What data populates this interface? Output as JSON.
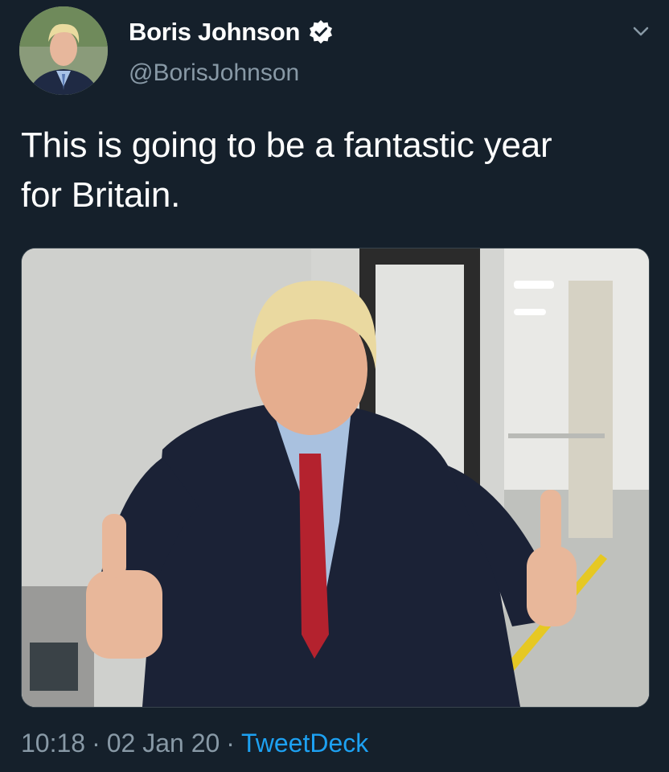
{
  "author": {
    "display_name": "Boris Johnson",
    "handle": "@BorisJohnson",
    "verified": true,
    "avatar_icon": "profile-photo"
  },
  "tweet": {
    "text_line1": "This is going to be a fantastic year",
    "text_line2": "for Britain.",
    "media": "photo-man-thumbs-up-in-corridor"
  },
  "footer": {
    "time": "10:18",
    "date": "02 Jan 20",
    "separator": "·",
    "source": "TweetDeck"
  },
  "colors": {
    "background": "#15202b",
    "secondary_text": "#8899a6",
    "link": "#1da1f2"
  }
}
